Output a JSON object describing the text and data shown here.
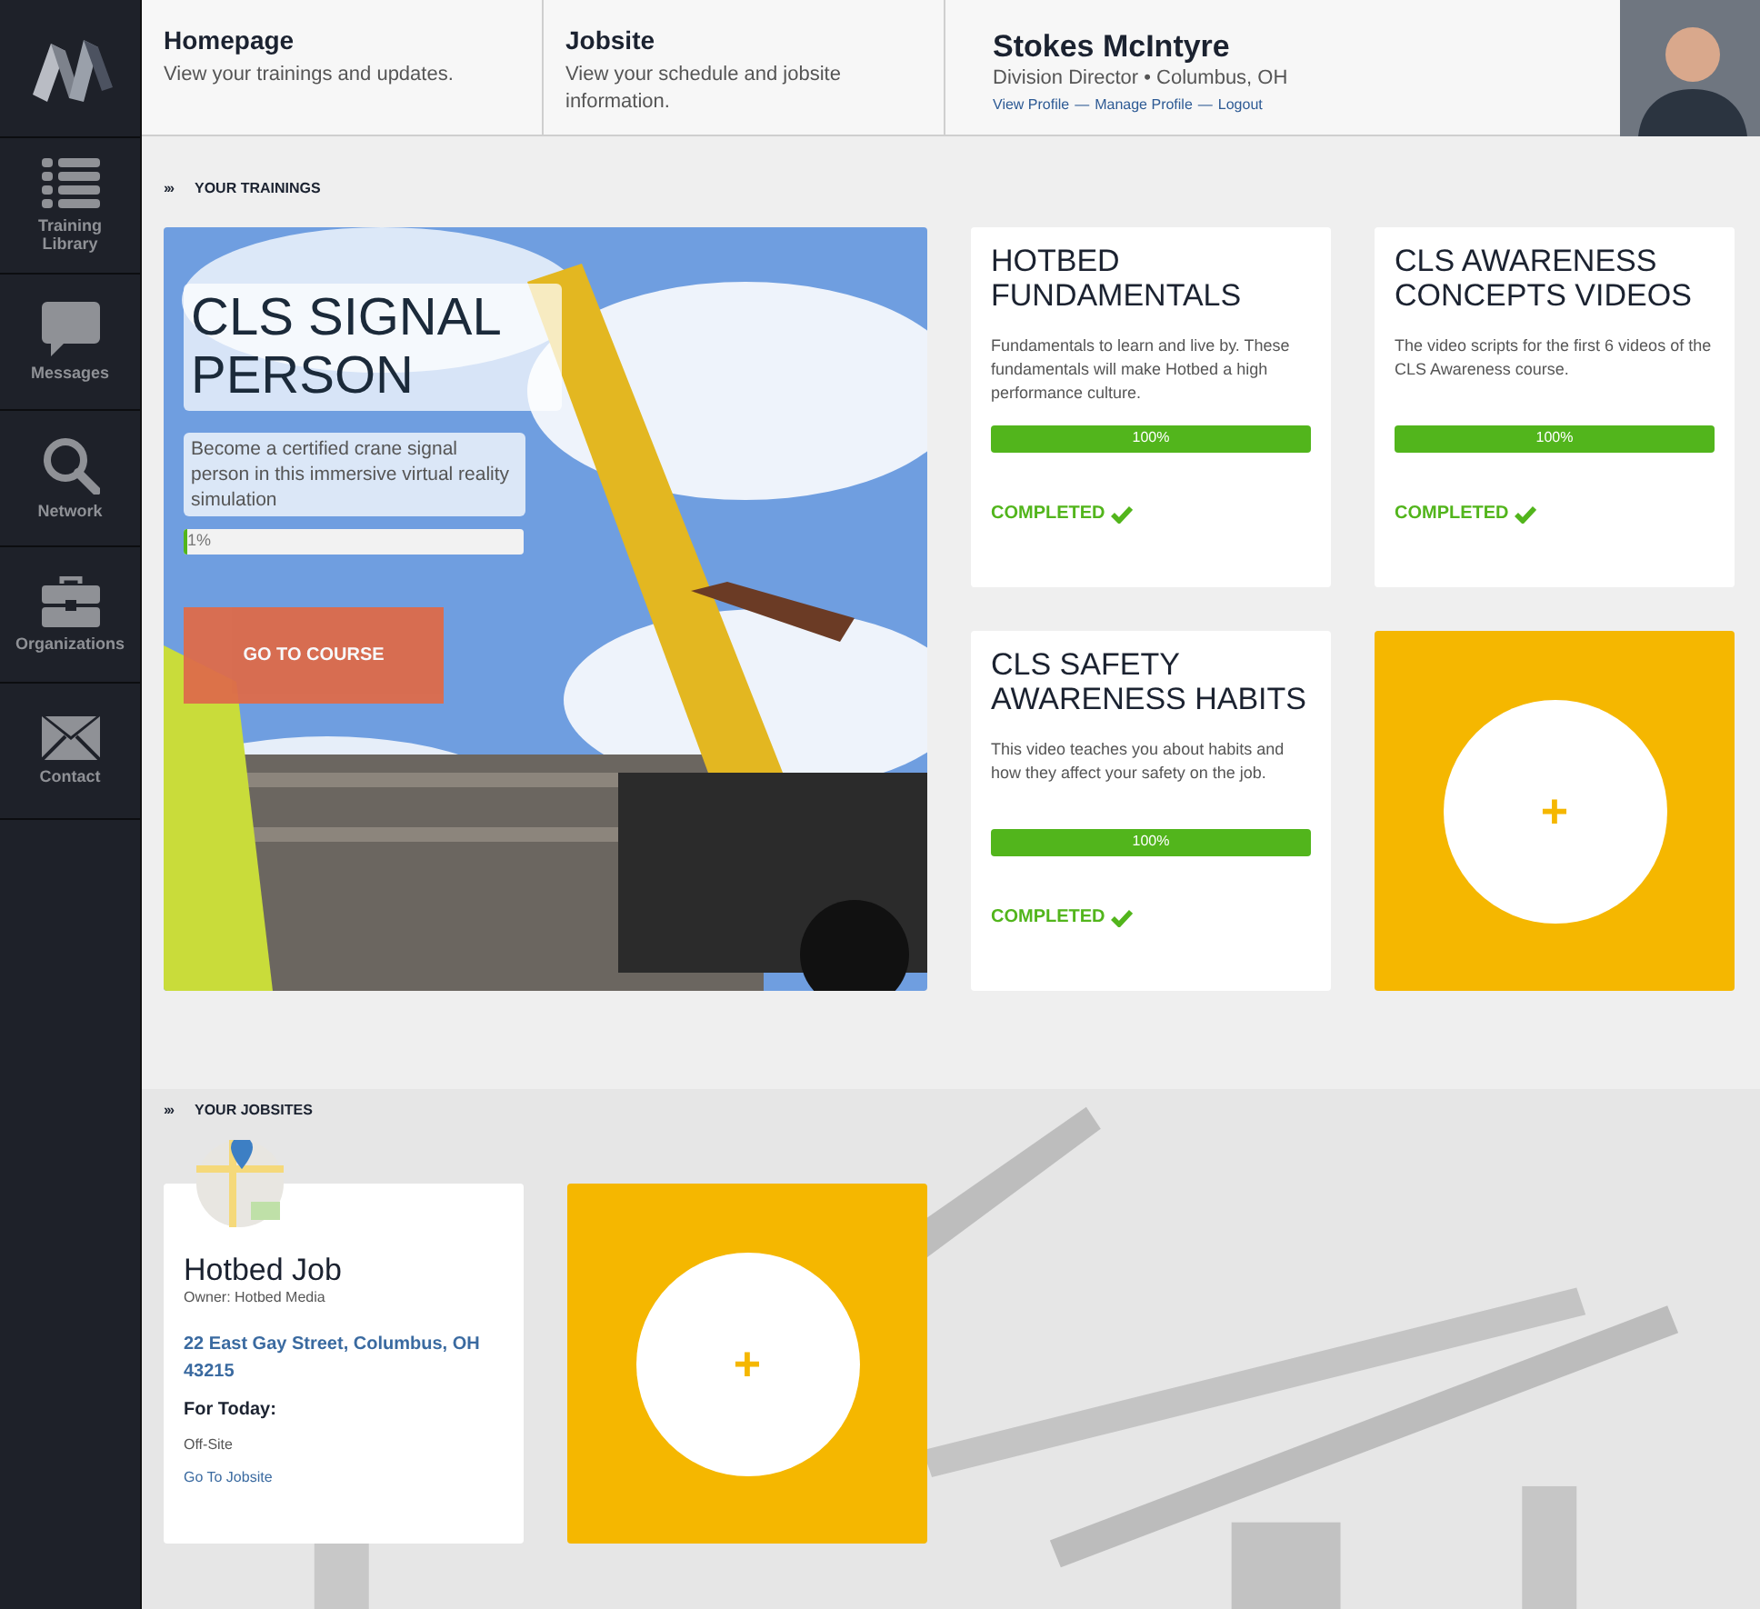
{
  "header": {
    "nav": [
      {
        "title": "Homepage",
        "subtitle": "View your trainings and updates."
      },
      {
        "title": "Jobsite",
        "subtitle": "View your schedule and jobsite information."
      }
    ],
    "profile": {
      "name": "Stokes McIntyre",
      "role": "Division Director • Columbus, OH",
      "links": [
        "View Profile",
        "Manage Profile",
        "Logout"
      ],
      "separators": [
        "—",
        "—"
      ]
    }
  },
  "sidebar": {
    "items": [
      {
        "kind": "list",
        "label": "Training Library"
      },
      {
        "kind": "bubble",
        "label": "Messages"
      },
      {
        "kind": "search",
        "label": "Network"
      },
      {
        "kind": "briefcase",
        "label": "Organizations"
      },
      {
        "kind": "envelope",
        "label": "Contact"
      }
    ]
  },
  "trainings": {
    "marker": "›››",
    "heading": "YOUR TRAININGS",
    "featured": {
      "title": "CLS SIGNAL PERSON",
      "description": "Become a certified crane signal person in this immersive virtual reality simulation",
      "progress": "1%",
      "level": 0.01,
      "button": "GO TO COURSE"
    },
    "cards": [
      {
        "kind": "course",
        "title": "HOTBED FUNDAMENTALS",
        "description": "Fundamentals to learn and live by. These fundamentals will make Hotbed a high performance culture.",
        "progress": "100%",
        "level": 1,
        "status": "COMPLETED",
        "completed": true
      },
      {
        "kind": "course",
        "title": "CLS AWARENESS CONCEPTS VIDEOS",
        "description": "The video scripts for the first 6 videos of the CLS Awareness course.",
        "progress": "100%",
        "level": 1,
        "status": "COMPLETED",
        "completed": true
      },
      {
        "kind": "course",
        "title": "CLS SAFETY AWARENESS HABITS",
        "description": "This video teaches you about habits and how they affect your safety on the job.",
        "progress": "100%",
        "level": 1,
        "status": "COMPLETED",
        "completed": true
      },
      {
        "kind": "add",
        "symbol": "+"
      }
    ]
  },
  "jobsites": {
    "marker": "›››",
    "heading": "YOUR JOBSITES",
    "cards": [
      {
        "kind": "jobsite",
        "name": "Hotbed Job",
        "owner": "Owner: Hotbed Media",
        "address": "22 East Gay Street, Columbus, OH 43215",
        "today_label": "For Today:",
        "today": "Off-Site",
        "link": "Go To Jobsite"
      },
      {
        "kind": "add",
        "symbol": "+"
      }
    ]
  }
}
